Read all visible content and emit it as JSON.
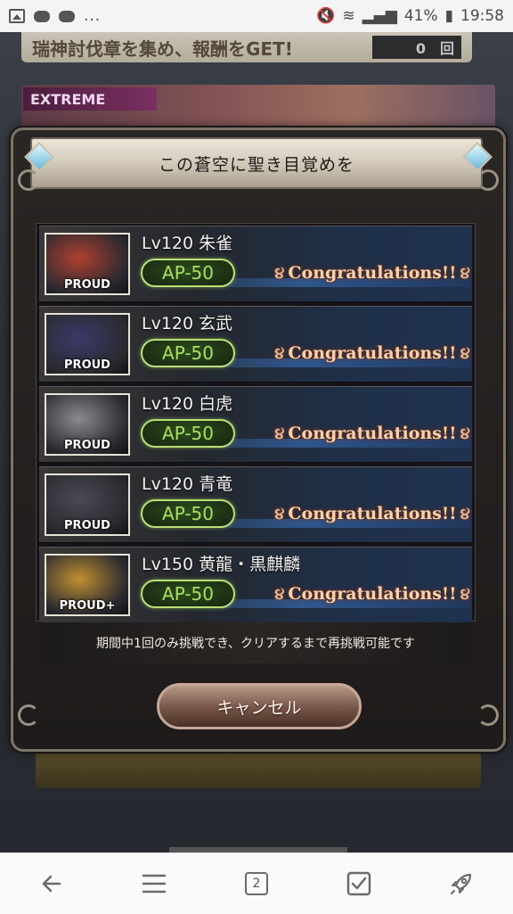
{
  "status_bar": {
    "ellipsis": "...",
    "battery": "41%",
    "time": "19:58"
  },
  "background": {
    "top_banner_text": "瑞神討伐章を集め、報酬をGET!",
    "top_banner_count": "0　回",
    "extreme_label": "EXTREME"
  },
  "dialog": {
    "title": "この蒼空に聖き目覚めを",
    "quests": [
      {
        "name": "Lv120 朱雀",
        "tag": "PROUD",
        "ap": "AP-50",
        "status": "Congratulations!!",
        "accent": "#b04030"
      },
      {
        "name": "Lv120 玄武",
        "tag": "PROUD",
        "ap": "AP-50",
        "status": "Congratulations!!",
        "accent": "#3a3a6a"
      },
      {
        "name": "Lv120 白虎",
        "tag": "PROUD",
        "ap": "AP-50",
        "status": "Congratulations!!",
        "accent": "#8a8a90"
      },
      {
        "name": "Lv120 青竜",
        "tag": "PROUD",
        "ap": "AP-50",
        "status": "Congratulations!!",
        "accent": "#4a4a54"
      },
      {
        "name": "Lv150 黄龍・黒麒麟",
        "tag": "PROUD+",
        "ap": "AP-50",
        "status": "Congratulations!!",
        "accent": "#c09030"
      }
    ],
    "notice": "期間中1回のみ挑戦でき、クリアするまで再挑戦可能です",
    "cancel_label": "キャンセル"
  },
  "bottom_nav": {
    "tab_count": "2"
  },
  "colors": {
    "ap_green": "#a8e060",
    "congrats_text": "#f4d4b0"
  }
}
